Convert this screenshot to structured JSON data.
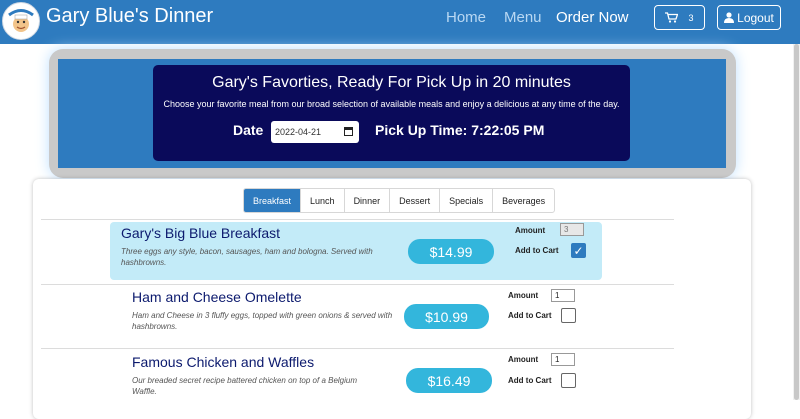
{
  "navbar": {
    "brand": "Gary Blue's Dinner",
    "links": [
      "Home",
      "Menu",
      "Order Now"
    ],
    "cart_count": "3",
    "logout_label": "Logout"
  },
  "hero": {
    "title": "Gary's Favorties, Ready For Pick Up in 20 minutes",
    "subtitle": "Choose your favorite meal from our broad selection of available meals and enjoy a delicious at any time of the day.",
    "date_label": "Date",
    "date_value": "2022-04-21",
    "pickup_text": "Pick Up Time: 7:22:05 PM"
  },
  "tabs": [
    "Breakfast",
    "Lunch",
    "Dinner",
    "Dessert",
    "Specials",
    "Beverages"
  ],
  "active_tab": "Breakfast",
  "labels": {
    "amount": "Amount",
    "add_to_cart": "Add to Cart"
  },
  "items": [
    {
      "name": "Gary's Big Blue Breakfast",
      "description": "Three eggs any style, bacon, sausages, ham and bologna. Served with hashbrowns.",
      "price": "$14.99",
      "amount": "3",
      "in_cart": true
    },
    {
      "name": "Ham and Cheese Omelette",
      "description": "Ham and Cheese in 3 fluffy eggs, topped with green onions & served with hashbrowns.",
      "price": "$10.99",
      "amount": "1",
      "in_cart": false
    },
    {
      "name": "Famous Chicken and Waffles",
      "description": "Our breaded secret recipe battered chicken on top of a Belgium Waffle.",
      "price": "$16.49",
      "amount": "1",
      "in_cart": false
    }
  ],
  "colors": {
    "navbar": "#2e7bbf",
    "hero_box": "#0a0a5a",
    "price_pill": "#33b6dc",
    "highlight_row": "#c3ebf8"
  }
}
